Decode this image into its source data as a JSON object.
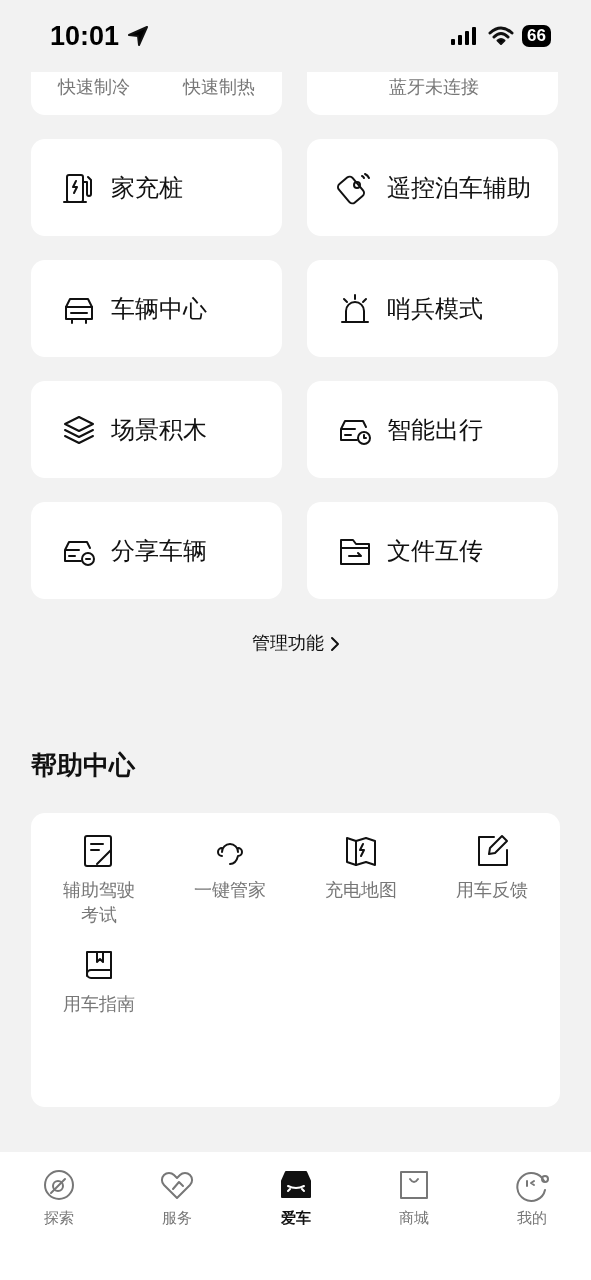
{
  "status_bar": {
    "time": "10:01",
    "battery": "66"
  },
  "top_cards": [
    {
      "kind": "climate",
      "labels": [
        "快速制冷",
        "快速制热"
      ]
    },
    {
      "kind": "key",
      "status": "蓝牙未连接"
    }
  ],
  "features": [
    {
      "label": "家充桩"
    },
    {
      "label": "遥控泊车辅助"
    },
    {
      "label": "车辆中心"
    },
    {
      "label": "哨兵模式"
    },
    {
      "label": "场景积木"
    },
    {
      "label": "智能出行"
    },
    {
      "label": "分享车辆"
    },
    {
      "label": "文件互传"
    }
  ],
  "manage_link": "管理功能",
  "help_center": {
    "title": "帮助中心",
    "items": [
      {
        "label": "辅助驾驶考试"
      },
      {
        "label": "一键管家"
      },
      {
        "label": "充电地图"
      },
      {
        "label": "用车反馈"
      },
      {
        "label": "用车指南"
      }
    ]
  },
  "tab_bar": [
    {
      "label": "探索",
      "selected": false
    },
    {
      "label": "服务",
      "selected": false
    },
    {
      "label": "爱车",
      "selected": true
    },
    {
      "label": "商城",
      "selected": false
    },
    {
      "label": "我的",
      "selected": false
    }
  ]
}
